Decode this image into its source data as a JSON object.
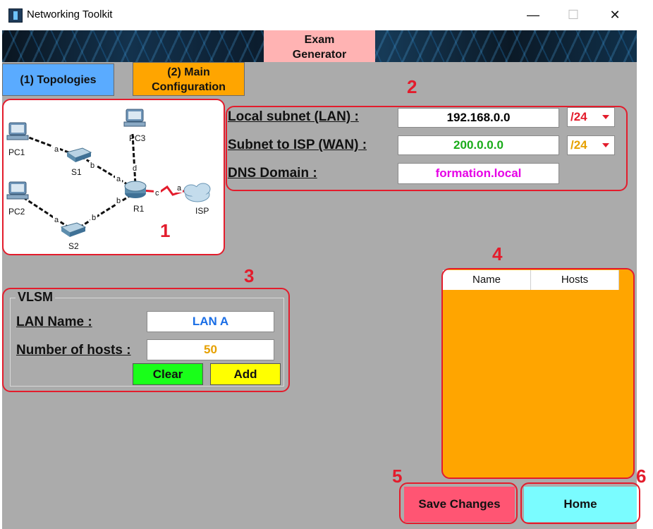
{
  "window": {
    "title": "Networking Toolkit",
    "controls": {
      "minimize": "—",
      "maximize": "☐",
      "close": "✕"
    }
  },
  "banner": {
    "exam_tab": [
      "Exam",
      "Generator"
    ]
  },
  "nav": {
    "topologies": "(1) Topologies",
    "main_configuration": [
      "(2) Main",
      "Configuration"
    ]
  },
  "annotations": [
    "1",
    "2",
    "3",
    "4",
    "5",
    "6"
  ],
  "topology": {
    "nodes": {
      "pc1": "PC1",
      "pc2": "PC2",
      "pc3": "PC3",
      "s1": "S1",
      "s2": "S2",
      "r1": "R1",
      "isp": "ISP"
    },
    "ports": {
      "pc1_s1": "a",
      "s1_r1_s": "b",
      "s1_r1_r": "a",
      "pc2_s2": "a",
      "s2_r1_s": "b",
      "s2_r1_r": "b",
      "pc3_r1": "d",
      "r1_isp_r": "c",
      "r1_isp_i": "a"
    }
  },
  "subnets": {
    "lan_label": "Local subnet (LAN) :",
    "lan_value": "192.168.0.0",
    "lan_prefix": "/24",
    "wan_label": "Subnet to ISP (WAN) :",
    "wan_value": "200.0.0.0",
    "wan_prefix": "/24",
    "dns_label": "DNS Domain :",
    "dns_value": "formation.local"
  },
  "vlsm": {
    "title": "VLSM",
    "lan_name_label": "LAN Name :",
    "lan_name_value": "LAN A",
    "hosts_label": "Number of hosts :",
    "hosts_value": "50",
    "clear": "Clear",
    "add": "Add"
  },
  "table": {
    "columns": [
      "Name",
      "Hosts"
    ],
    "rows": []
  },
  "footer": {
    "save": "Save Changes",
    "home": "Home"
  },
  "colors": {
    "lan_value": "#000000",
    "lan_prefix": "#e31c2c",
    "wan_value": "#1aab1a",
    "wan_prefix": "#e6a000",
    "dns_value": "#e600e6",
    "lan_name": "#1a6ee6",
    "hosts": "#e6a000",
    "clear_btn": "#19ff19",
    "add_btn": "#ffff00",
    "annotation": "#e31c2c"
  }
}
